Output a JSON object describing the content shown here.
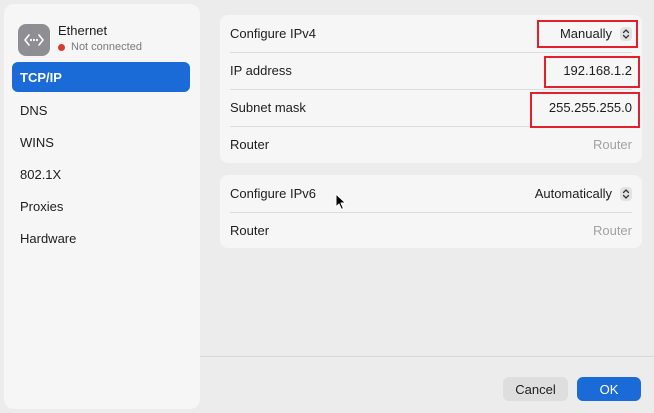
{
  "service": {
    "name": "Ethernet",
    "status": "Not connected",
    "icon": "ethernet-icon",
    "status_color": "#e0372c"
  },
  "sidebar": {
    "items": [
      {
        "label": "TCP/IP",
        "selected": true
      },
      {
        "label": "DNS",
        "selected": false
      },
      {
        "label": "WINS",
        "selected": false
      },
      {
        "label": "802.1X",
        "selected": false
      },
      {
        "label": "Proxies",
        "selected": false
      },
      {
        "label": "Hardware",
        "selected": false
      }
    ]
  },
  "ipv4": {
    "configure_label": "Configure IPv4",
    "configure_value": "Manually",
    "ip_label": "IP address",
    "ip_value": "192.168.1.2",
    "subnet_label": "Subnet mask",
    "subnet_value": "255.255.255.0",
    "router_label": "Router",
    "router_placeholder": "Router"
  },
  "ipv6": {
    "configure_label": "Configure IPv6",
    "configure_value": "Automatically",
    "router_label": "Router",
    "router_placeholder": "Router"
  },
  "footer": {
    "cancel_label": "Cancel",
    "ok_label": "OK"
  },
  "colors": {
    "accent": "#1a6ad8",
    "highlight": "#e3202b"
  }
}
